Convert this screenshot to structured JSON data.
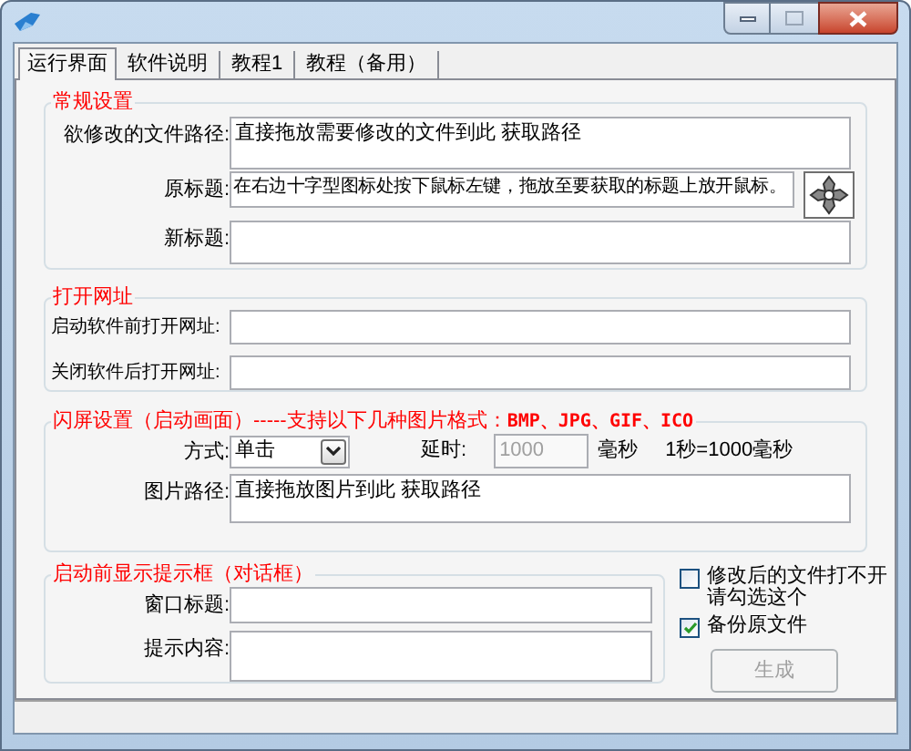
{
  "tabs": [
    {
      "label": "运行界面",
      "selected": true
    },
    {
      "label": "软件说明",
      "selected": false
    },
    {
      "label": "教程1",
      "selected": false
    },
    {
      "label": "教程（备用）",
      "selected": false
    }
  ],
  "general": {
    "title": "常规设置",
    "file_path": {
      "label": "欲修改的文件路径:",
      "value": "直接拖放需要修改的文件到此 获取路径"
    },
    "original_title": {
      "label": "原标题:",
      "value": "在右边十字型图标处按下鼠标左键，拖放至要获取的标题上放开鼠标。"
    },
    "new_title": {
      "label": "新标题:"
    }
  },
  "open_url": {
    "title": "打开网址",
    "fields": [
      {
        "label": "启动软件前打开网址:"
      },
      {
        "label": "关闭软件后打开网址:"
      }
    ]
  },
  "splash": {
    "title": "闪屏设置（启动画面）-----支持以下几种图片格式：",
    "formats": "BMP、JPG、GIF、ICO",
    "mode": {
      "label": "方式:",
      "value": "单击"
    },
    "delay": {
      "label": "延时:",
      "value": "1000",
      "disabled": true,
      "unit": "毫秒"
    },
    "note": "1秒=1000毫秒",
    "image_path": {
      "label": "图片路径:",
      "value": "直接拖放图片到此 获取路径"
    }
  },
  "dialog": {
    "title": "启动前显示提示框（对话框）",
    "fields": [
      {
        "label": "窗口标题:"
      },
      {
        "label": "提示内容:"
      }
    ]
  },
  "options": [
    {
      "label": "修改后的文件打不开请勾选这个",
      "checked": false
    },
    {
      "label": "备份原文件",
      "checked": true
    }
  ],
  "generate_button": {
    "label": "生成",
    "disabled": true
  }
}
